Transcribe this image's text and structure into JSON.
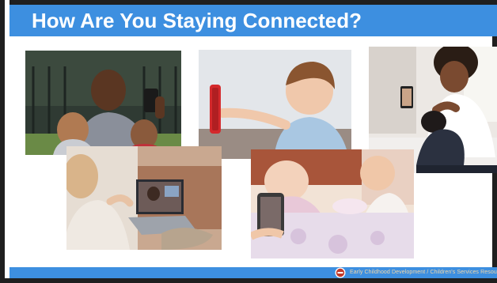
{
  "slide": {
    "title": "How Are You Staying Connected?",
    "footer_text": "Early Childhood Development / Children's Services Resource",
    "colors": {
      "title_bar": "#3d8fe0",
      "title_text": "#ffffff",
      "frame": "#1f1f1f",
      "footer_logo": "#c0392b"
    }
  },
  "photos": [
    {
      "subject": "father with two young children taking a selfie outdoors"
    },
    {
      "subject": "toddler holding a red phone for a video call"
    },
    {
      "subject": "mother holding a baby while on a video call on a phone"
    },
    {
      "subject": "woman on a video call with a laptop on a sofa"
    },
    {
      "subject": "mother showing a phone to a baby lying on a bed"
    }
  ]
}
